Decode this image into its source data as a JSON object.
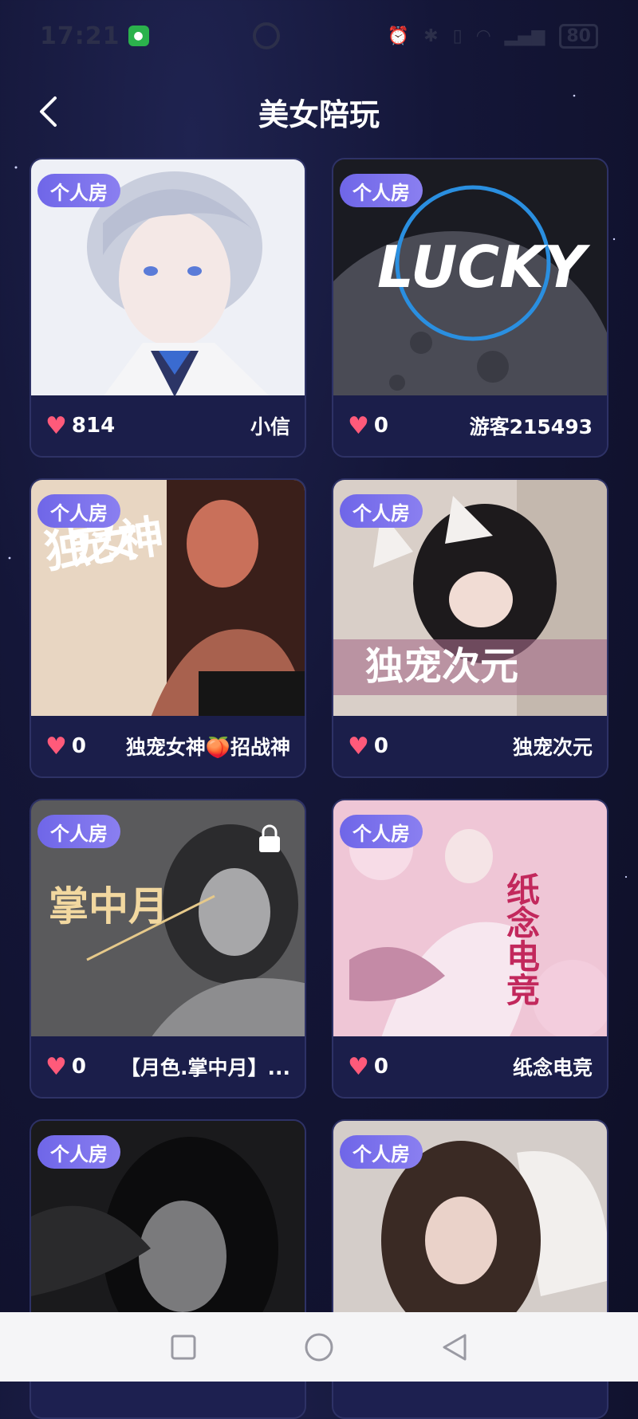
{
  "status": {
    "time": "17:21",
    "battery": "80"
  },
  "header": {
    "title": "美女陪玩"
  },
  "tag_label": "个人房",
  "cards": [
    {
      "likes": "814",
      "name": "小信"
    },
    {
      "likes": "0",
      "name": "游客215493",
      "art_text": "LUCKY"
    },
    {
      "likes": "0",
      "name": "独宠女神🍑招战神",
      "art_text": "独宠女神"
    },
    {
      "likes": "0",
      "name": "独宠次元",
      "art_text": "独宠次元"
    },
    {
      "likes": "0",
      "name": "【月色.掌中月】...",
      "art_text": "掌中月",
      "locked": true
    },
    {
      "likes": "0",
      "name": "纸念电竞",
      "art_text": "纸念电竞"
    },
    {
      "likes": "",
      "name": ""
    },
    {
      "likes": "",
      "name": ""
    }
  ],
  "colors": {
    "accent": "#7a6ff0",
    "heart": "#ff5a7a",
    "card_bg": "#1d2050"
  }
}
